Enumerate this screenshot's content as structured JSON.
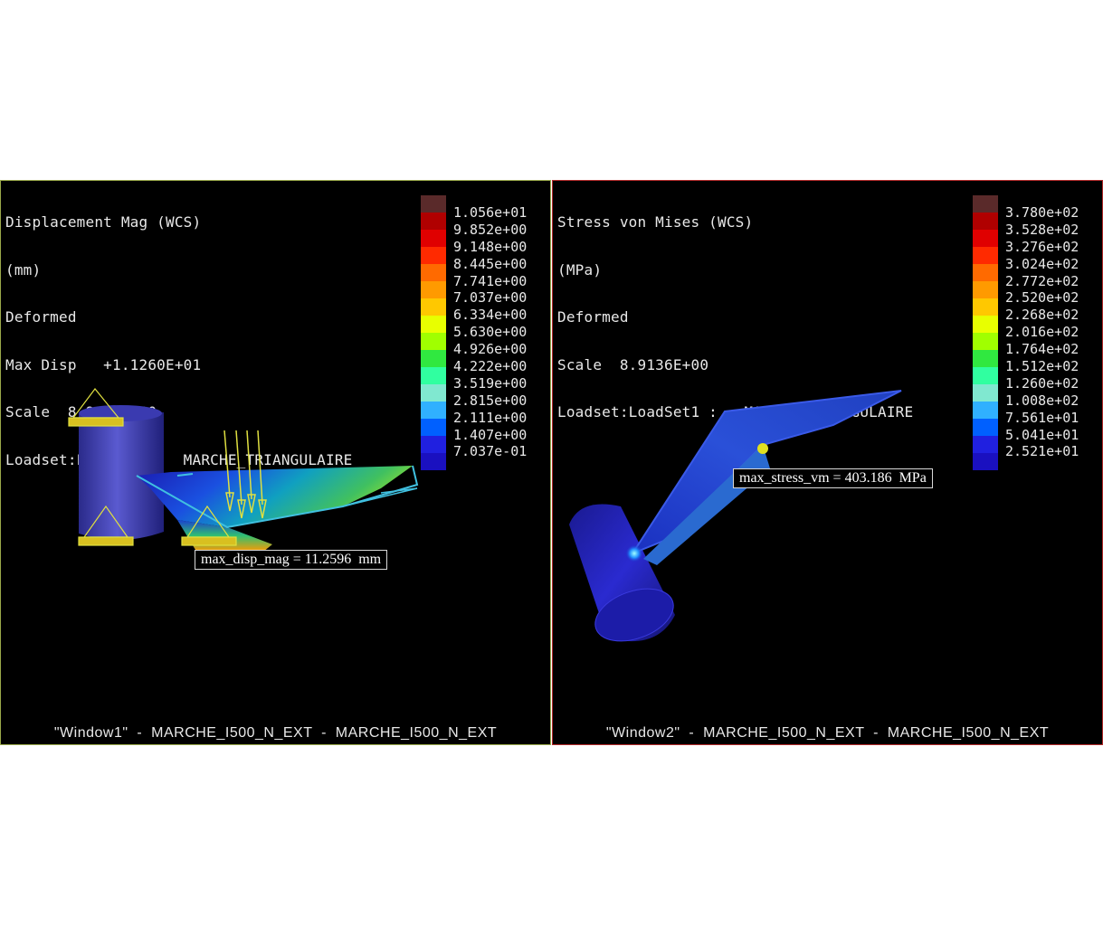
{
  "window1": {
    "header_lines": [
      "Displacement Mag (WCS)",
      "(mm)",
      "Deformed",
      "Max Disp   +1.1260E+01",
      "Scale  8.9136E+00",
      "Loadset:LoadSet1 :  MARCHE_TRIANGULAIRE"
    ],
    "legend_values": [
      "1.056e+01",
      "9.852e+00",
      "9.148e+00",
      "8.445e+00",
      "7.741e+00",
      "7.037e+00",
      "6.334e+00",
      "5.630e+00",
      "4.926e+00",
      "4.222e+00",
      "3.519e+00",
      "2.815e+00",
      "2.111e+00",
      "1.407e+00",
      "7.037e-01"
    ],
    "callout": "max_disp_mag = 11.2596  mm",
    "footer": "\"Window1\"  -  MARCHE_I500_N_EXT  -  MARCHE_I500_N_EXT"
  },
  "window2": {
    "header_lines": [
      "Stress von Mises (WCS)",
      "(MPa)",
      "Deformed",
      "Scale  8.9136E+00",
      "Loadset:LoadSet1 :   MARCHE_TRIANGULAIRE"
    ],
    "legend_values": [
      "3.780e+02",
      "3.528e+02",
      "3.276e+02",
      "3.024e+02",
      "2.772e+02",
      "2.520e+02",
      "2.268e+02",
      "2.016e+02",
      "1.764e+02",
      "1.512e+02",
      "1.260e+02",
      "1.008e+02",
      "7.561e+01",
      "5.041e+01",
      "2.521e+01"
    ],
    "callout": "max_stress_vm = 403.186  MPa",
    "footer": "\"Window2\"  -  MARCHE_I500_N_EXT  -  MARCHE_I500_N_EXT"
  },
  "legend_colors": [
    "#5a2a2a",
    "#b00000",
    "#e00000",
    "#ff2a00",
    "#ff6a00",
    "#ff9a00",
    "#ffc800",
    "#e8ff00",
    "#a0ff00",
    "#30e840",
    "#30ffa0",
    "#80e8d0",
    "#30b0ff",
    "#0060ff",
    "#2020e0",
    "#1a10c0"
  ]
}
